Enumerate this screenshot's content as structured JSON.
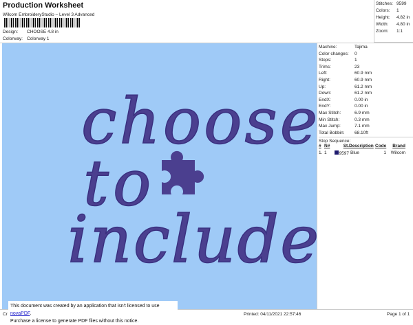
{
  "header": {
    "title": "Production Worksheet",
    "subtitle": "Wilcom EmbroideryStudio – Level 3 Advanced",
    "design_label": "Design:",
    "design_value": "CHOOSE 4.8 in",
    "colorway_label": "Colorway:",
    "colorway_value": "Colorway 1"
  },
  "summary": [
    {
      "k": "Stitches:",
      "v": "9599"
    },
    {
      "k": "Colors:",
      "v": "1"
    },
    {
      "k": "Height:",
      "v": "4.82 in"
    },
    {
      "k": "Width:",
      "v": "4.80 in"
    },
    {
      "k": "Zoom:",
      "v": "1:1"
    }
  ],
  "details": [
    {
      "k": "Machine:",
      "v": "Tajima"
    },
    {
      "k": "Color changes:",
      "v": "0"
    },
    {
      "k": "Stops:",
      "v": "1"
    },
    {
      "k": "Trims:",
      "v": "23"
    },
    {
      "k": "Left:",
      "v": "60.9 mm"
    },
    {
      "k": "Right:",
      "v": "60.9 mm"
    },
    {
      "k": "Up:",
      "v": "61.2 mm"
    },
    {
      "k": "Down:",
      "v": "61.2 mm"
    },
    {
      "k": "EndX:",
      "v": "0.00 in"
    },
    {
      "k": "EndY:",
      "v": "0.00 in"
    },
    {
      "k": "Max Stitch:",
      "v": "6.9 mm"
    },
    {
      "k": "Min Stitch:",
      "v": "0.3 mm"
    },
    {
      "k": "Max Jump:",
      "v": "7.1 mm"
    },
    {
      "k": "Total Bobbin:",
      "v": "68.10ft"
    }
  ],
  "stop_sequence": {
    "title": "Stop Sequence:",
    "headers": [
      "#",
      "N#",
      "St.",
      "Description",
      "Code",
      "Brand"
    ],
    "rows": [
      {
        "n": "1.",
        "nn": "1",
        "st": "9597",
        "desc": "Blue",
        "code": "1",
        "brand": "Wilcom",
        "color": "#1e1a6e"
      }
    ]
  },
  "design": {
    "lines": [
      "choose",
      "to",
      "include"
    ],
    "thread_color": "#4b3f8f",
    "background": "#9fcaf7"
  },
  "footer": {
    "left": "Cr",
    "printed": "Printed: 04/11/2021 22:57:46",
    "page": "Page 1 of 1"
  },
  "notice": {
    "line1": "This document was created by an application that isn't licensed to use ",
    "link": "novaPDF",
    "line1_end": ".",
    "line2": "Purchase a license to generate PDF files without this notice."
  }
}
